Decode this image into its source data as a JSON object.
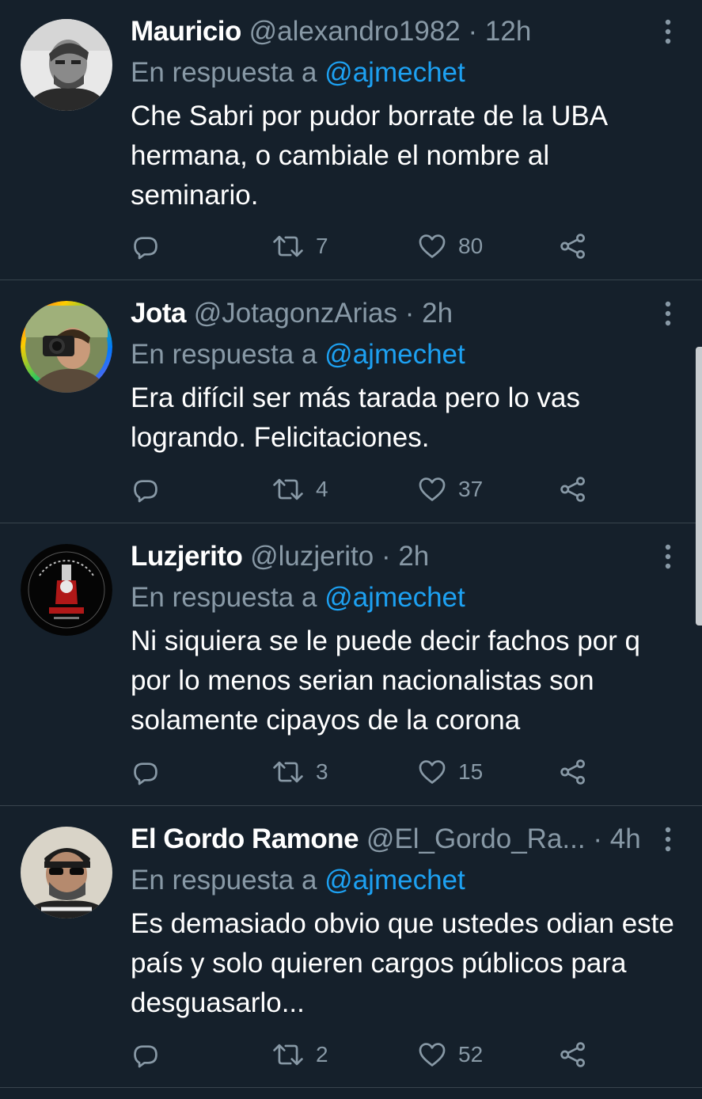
{
  "tweets": [
    {
      "name": "Mauricio",
      "handle": "@alexandro1982",
      "separator": "·",
      "time": "12h",
      "reply_prefix": "En respuesta a",
      "reply_to": "@ajmechet",
      "text": "Che Sabri por pudor borrate de la UBA hermana, o cambiale el nombre al seminario.",
      "retweets": "7",
      "likes": "80",
      "avatar_icon": "grayscale-man-avatar"
    },
    {
      "name": "Jota",
      "handle": "@JotagonzArias",
      "separator": "·",
      "time": "2h",
      "reply_prefix": "En respuesta a",
      "reply_to": "@ajmechet",
      "text": "Era difícil ser más tarada pero lo vas logrando. Felicitaciones.",
      "retweets": "4",
      "likes": "37",
      "avatar_icon": "camera-photographer-avatar-rainbow-ring"
    },
    {
      "name": "Luzjerito",
      "handle": "@luzjerito",
      "separator": "·",
      "time": "2h",
      "reply_prefix": "En respuesta a",
      "reply_to": "@ajmechet",
      "text": "Ni siquiera se le puede decir fachos por q por lo menos serian nacionalistas son solamente cipayos de la corona",
      "retweets": "3",
      "likes": "15",
      "avatar_icon": "black-circular-badge-avatar"
    },
    {
      "name": "El Gordo Ramone",
      "handle": "@El_Gordo_Ra...",
      "separator": "·",
      "time": "4h",
      "reply_prefix": "En respuesta a",
      "reply_to": "@ajmechet",
      "text": "Es demasiado obvio que ustedes odian este país y solo quieren cargos públicos para desguasarlo...",
      "retweets": "2",
      "likes": "52",
      "avatar_icon": "man-with-sunglasses-avatar"
    }
  ],
  "colors": {
    "background": "#15202b",
    "divider": "#38444d",
    "secondary_text": "#8899a6",
    "link": "#1da1f2"
  }
}
